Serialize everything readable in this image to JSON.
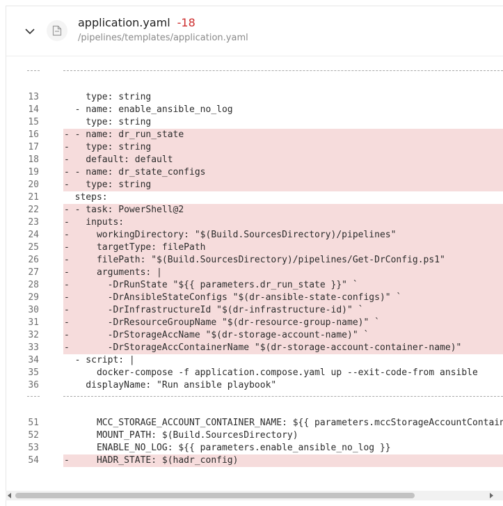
{
  "file": {
    "name": "application.yaml",
    "change_count": "-18",
    "path": "/pipelines/templates/application.yaml",
    "icon": "file-icon",
    "collapse_icon": "chevron-down-icon"
  },
  "separator_dots": "----",
  "colors": {
    "removed_bg": "#f6dcdc",
    "deletion_count": "#cd2d2d"
  },
  "hunks": [
    {
      "lines": [
        {
          "num": "13",
          "type": "context",
          "text": "    type: string"
        },
        {
          "num": "14",
          "type": "context",
          "text": "  - name: enable_ansible_no_log"
        },
        {
          "num": "15",
          "type": "context",
          "text": "    type: string"
        },
        {
          "num": "16",
          "type": "removed",
          "text": "- - name: dr_run_state"
        },
        {
          "num": "17",
          "type": "removed",
          "text": "-   type: string"
        },
        {
          "num": "18",
          "type": "removed",
          "text": "-   default: default"
        },
        {
          "num": "19",
          "type": "removed",
          "text": "- - name: dr_state_configs"
        },
        {
          "num": "20",
          "type": "removed",
          "text": "-   type: string"
        },
        {
          "num": "21",
          "type": "context",
          "text": "  steps:"
        },
        {
          "num": "22",
          "type": "removed",
          "text": "- - task: PowerShell@2"
        },
        {
          "num": "23",
          "type": "removed",
          "text": "-   inputs:"
        },
        {
          "num": "24",
          "type": "removed",
          "text": "-     workingDirectory: \"$(Build.SourcesDirectory)/pipelines\""
        },
        {
          "num": "25",
          "type": "removed",
          "text": "-     targetType: filePath"
        },
        {
          "num": "26",
          "type": "removed",
          "text": "-     filePath: \"$(Build.SourcesDirectory)/pipelines/Get-DrConfig.ps1\""
        },
        {
          "num": "27",
          "type": "removed",
          "text": "-     arguments: |"
        },
        {
          "num": "28",
          "type": "removed",
          "text": "-       -DrRunState \"${{ parameters.dr_run_state }}\" `"
        },
        {
          "num": "29",
          "type": "removed",
          "text": "-       -DrAnsibleStateConfigs \"$(dr-ansible-state-configs)\" `"
        },
        {
          "num": "30",
          "type": "removed",
          "text": "-       -DrInfrastructureId \"$(dr-infrastructure-id)\" `"
        },
        {
          "num": "31",
          "type": "removed",
          "text": "-       -DrResourceGroupName \"$(dr-resource-group-name)\" `"
        },
        {
          "num": "32",
          "type": "removed",
          "text": "-       -DrStorageAccName \"$(dr-storage-account-name)\" `"
        },
        {
          "num": "33",
          "type": "removed",
          "text": "-       -DrStorageAccContainerName \"$(dr-storage-account-container-name)\""
        },
        {
          "num": "34",
          "type": "context",
          "text": "  - script: |"
        },
        {
          "num": "35",
          "type": "context",
          "text": "      docker-compose -f application.compose.yaml up --exit-code-from ansible"
        },
        {
          "num": "36",
          "type": "context",
          "text": "    displayName: \"Run ansible playbook\""
        }
      ]
    },
    {
      "lines": [
        {
          "num": "51",
          "type": "context",
          "text": "      MCC_STORAGE_ACCOUNT_CONTAINER_NAME: ${{ parameters.mccStorageAccountContainer }}"
        },
        {
          "num": "52",
          "type": "context",
          "text": "      MOUNT_PATH: $(Build.SourcesDirectory)"
        },
        {
          "num": "53",
          "type": "context",
          "text": "      ENABLE_NO_LOG: ${{ parameters.enable_ansible_no_log }}"
        },
        {
          "num": "54",
          "type": "removed",
          "text": "-     HADR_STATE: $(hadr_config)"
        },
        {
          "num": "",
          "type": "context",
          "text": ""
        }
      ]
    }
  ]
}
